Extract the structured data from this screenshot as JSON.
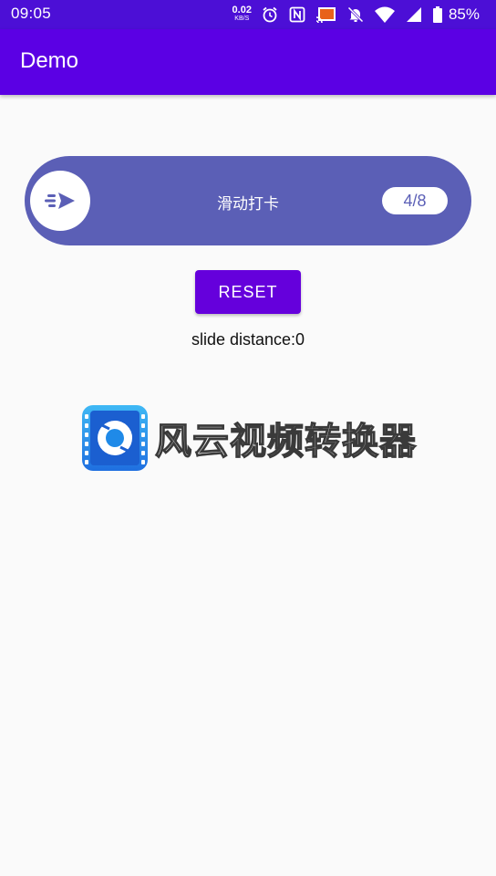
{
  "status_bar": {
    "time": "09:05",
    "net_speed_value": "0.02",
    "net_speed_unit": "KB/S",
    "battery": "85%",
    "icons": [
      "alarm-icon",
      "nfc-icon",
      "cast-icon",
      "mute-icon",
      "wifi-icon",
      "signal-icon",
      "battery-icon"
    ]
  },
  "app_bar": {
    "title": "Demo"
  },
  "slider": {
    "label": "滑动打卡",
    "count": "4/8",
    "thumb_icon": "send-icon",
    "colors": {
      "track": "#5b5fb6",
      "thumb": "#ffffff"
    }
  },
  "reset_button": {
    "label": "RESET"
  },
  "distance": {
    "text": "slide distance:0"
  },
  "watermark": {
    "text": "风云视频转换器",
    "logo_icon": "video-converter-logo-icon"
  },
  "colors": {
    "status_bar": "#4c0fd6",
    "app_bar": "#5b00e4",
    "accent": "#6500dc",
    "background": "#fafafa"
  }
}
